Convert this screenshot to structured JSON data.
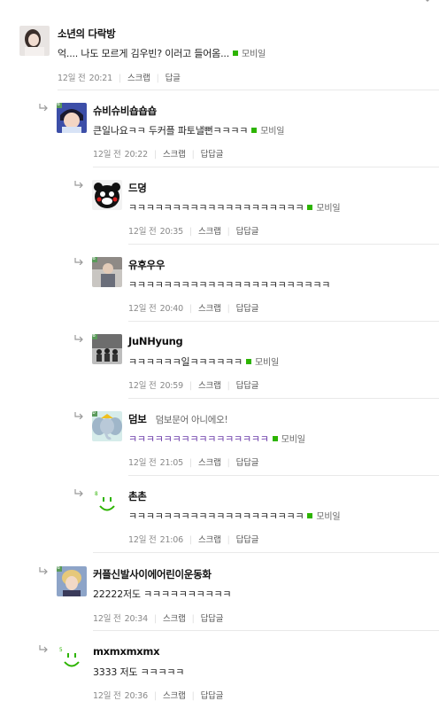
{
  "colors": {
    "mobile_dot": "#2db400",
    "divider": "#e9e9e9",
    "purple_text": "#6a3aa8"
  },
  "comments": [
    {
      "nick": "소년의 다락방",
      "extra": "",
      "text": "억.... 나도 모르게 김우빈? 이러고 들어옴...",
      "mobile": "모비일",
      "date": "12일 전",
      "time": "20:21",
      "scrap": "스크랩",
      "reply": "답글",
      "avatar_icon": "girl-photo-icon"
    },
    {
      "nick": "슈비슈비숍숍숍",
      "extra": "",
      "text": "큰일나요ㅋㅋ 두커플 파토낼뻔ㅋㅋㅋㅋ",
      "mobile": "모비일",
      "date": "12일 전",
      "time": "20:22",
      "scrap": "스크랩",
      "reply": "답답글",
      "avatar_icon": "anime-character-icon"
    },
    {
      "nick": "드뎡",
      "extra": "",
      "text": "ㅋㅋㅋㅋㅋㅋㅋㅋㅋㅋㅋㅋㅋㅋㅋㅋㅋㅋㅋㅋ",
      "mobile": "모비일",
      "date": "12일 전",
      "time": "20:35",
      "scrap": "스크랩",
      "reply": "답답글",
      "avatar_icon": "kumamon-icon"
    },
    {
      "nick": "유후우우",
      "extra": "",
      "text": "ㅋㅋㅋㅋㅋㅋㅋㅋㅋㅋㅋㅋㅋㅋㅋㅋㅋㅋㅋㅋㅋㅋㅋ",
      "mobile": "",
      "date": "12일 전",
      "time": "20:40",
      "scrap": "스크랩",
      "reply": "답답글",
      "avatar_icon": "person-photo-icon"
    },
    {
      "nick": "JuNHyung",
      "extra": "",
      "text": "ㅋㅋㅋㅋㅋㅋ일ㅋㅋㅋㅋㅋㅋ",
      "mobile": "모비일",
      "date": "12일 전",
      "time": "20:59",
      "scrap": "스크랩",
      "reply": "답답글",
      "avatar_icon": "group-photo-icon"
    },
    {
      "nick": "덤보",
      "extra": "덤보문어 아니에오!",
      "text": "ㅋㅋㅋㅋㅋㅋㅋㅋㅋㅋㅋㅋㅋㅋㅋㅋ",
      "mobile": "모비일",
      "date": "12일 전",
      "time": "21:05",
      "scrap": "스크랩",
      "reply": "답답글",
      "avatar_icon": "dumbo-icon"
    },
    {
      "nick": "촌촌",
      "extra": "",
      "text": "ㅋㅋㅋㅋㅋㅋㅋㅋㅋㅋㅋㅋㅋㅋㅋㅋㅋㅋㅋㅋ",
      "mobile": "모비일",
      "date": "12일 전",
      "time": "21:06",
      "scrap": "스크랩",
      "reply": "답답글",
      "avatar_icon": "smile-default-icon"
    },
    {
      "nick": "커플신발사이에어린이운동화",
      "extra": "",
      "text": "22222저도 ㅋㅋㅋㅋㅋㅋㅋㅋㅋㅋ",
      "mobile": "",
      "date": "12일 전",
      "time": "20:34",
      "scrap": "스크랩",
      "reply": "답답글",
      "avatar_icon": "blonde-person-icon"
    },
    {
      "nick": "mxmxmxmx",
      "extra": "",
      "text": "3333 저도 ㅋㅋㅋㅋㅋ",
      "mobile": "",
      "date": "12일 전",
      "time": "20:36",
      "scrap": "스크랩",
      "reply": "답답글",
      "avatar_icon": "smile-default-icon"
    }
  ]
}
